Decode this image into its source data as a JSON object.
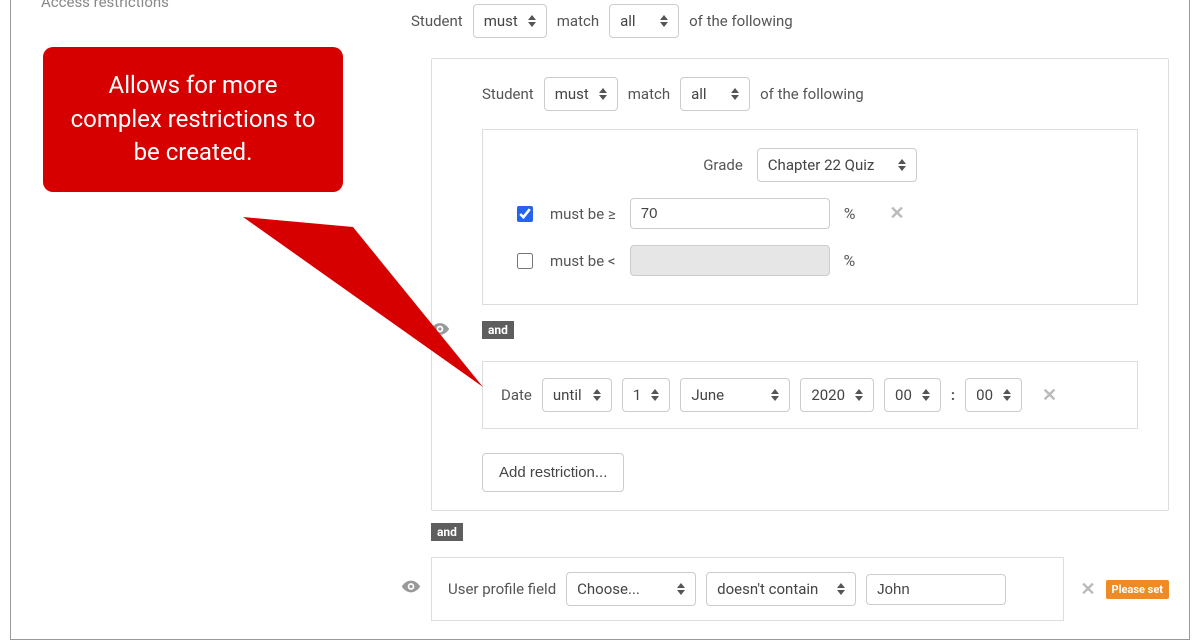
{
  "section_label": "Access restrictions",
  "callout_text": "Allows for more complex restrictions to be created.",
  "outer": {
    "student_label": "Student",
    "must": "must",
    "match_label": "match",
    "all": "all",
    "of_following": "of the following"
  },
  "nested": {
    "student_label": "Student",
    "must": "must",
    "match_label": "match",
    "all": "all",
    "of_following": "of the following",
    "grade": {
      "label": "Grade",
      "item": "Chapter 22 Quiz",
      "min_checked": true,
      "min_label": "must be ≥",
      "min_value": "70",
      "max_checked": false,
      "max_label": "must be <",
      "max_value": "",
      "pct": "%"
    },
    "and_label": "and",
    "date": {
      "label": "Date",
      "direction": "until",
      "day": "1",
      "month": "June",
      "year": "2020",
      "hour": "00",
      "minute": "00",
      "colon": ":"
    },
    "add_restriction": "Add restriction..."
  },
  "outer_and": "and",
  "profile": {
    "label": "User profile field",
    "field": "Choose...",
    "operator": "doesn't contain",
    "value": "John",
    "please_set": "Please set"
  }
}
